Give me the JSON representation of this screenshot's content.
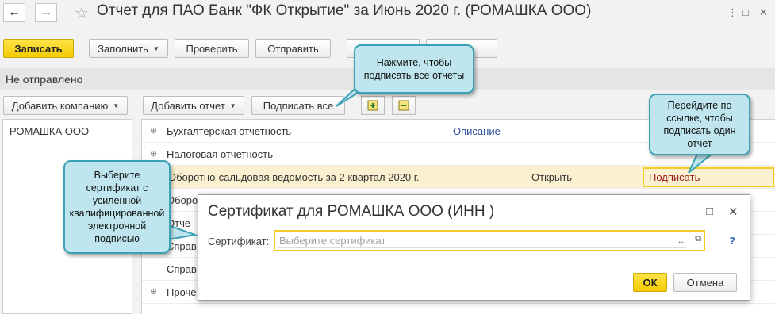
{
  "window": {
    "title": "Отчет для ПАО Банк \"ФК Открытие\" за Июнь 2020 г. (РОМАШКА ООО)",
    "back_icon": "arrow-left-icon",
    "forward_icon": "arrow-right-icon",
    "star_icon": "star-icon",
    "menu_icon": "more-vertical-icon",
    "maximize_icon": "maximize-icon",
    "close_icon": "close-icon"
  },
  "toolbar": {
    "save_label": "Записать",
    "fill_label": "Заполнить",
    "check_label": "Проверить",
    "send_label": "Отправить"
  },
  "status": {
    "text": "Не отправлено"
  },
  "left_panel": {
    "add_company_label": "Добавить компанию",
    "companies": [
      "РОМАШКА ООО"
    ]
  },
  "right_toolbar": {
    "add_report_label": "Добавить отчет",
    "sign_all_label": "Подписать все",
    "expand_icon": "expand-all-icon",
    "collapse_icon": "collapse-all-icon"
  },
  "reports": {
    "rows": [
      {
        "label": "Бухгалтерская отчетность",
        "link": "Описание"
      },
      {
        "label": "Налоговая отчетность"
      },
      {
        "label": "Оборотно-сальдовая ведомость за 2 квартал 2020 г.",
        "open": "Открыть",
        "sign": "Подписать"
      },
      {
        "label": "Оборо"
      },
      {
        "label": "Отче"
      },
      {
        "label": "Справ"
      },
      {
        "label": "Справ"
      },
      {
        "label": "Проче"
      }
    ]
  },
  "dialog": {
    "title": "Сертификат для РОМАШКА ООО (ИНН             )",
    "cert_label": "Сертификат:",
    "cert_placeholder": "Выберите сертификат",
    "dots": "...",
    "help": "?",
    "ok_label": "ОК",
    "cancel_label": "Отмена"
  },
  "callouts": {
    "sign_all": "Нажмите, чтобы подписать все отчеты",
    "sign_one": "Перейдите по ссылке, чтобы подписать один отчет",
    "certificate": "Выберите сертификат с усиленной квалифицированной электронной подписью"
  },
  "colors": {
    "primary_button": "#f4cb00",
    "callout_fill": "#bfe6ee",
    "callout_border": "#3aa2b4",
    "highlight_row": "#fbf0cf",
    "link_blue": "#2a4d9c",
    "link_red": "#9a1b1b"
  }
}
